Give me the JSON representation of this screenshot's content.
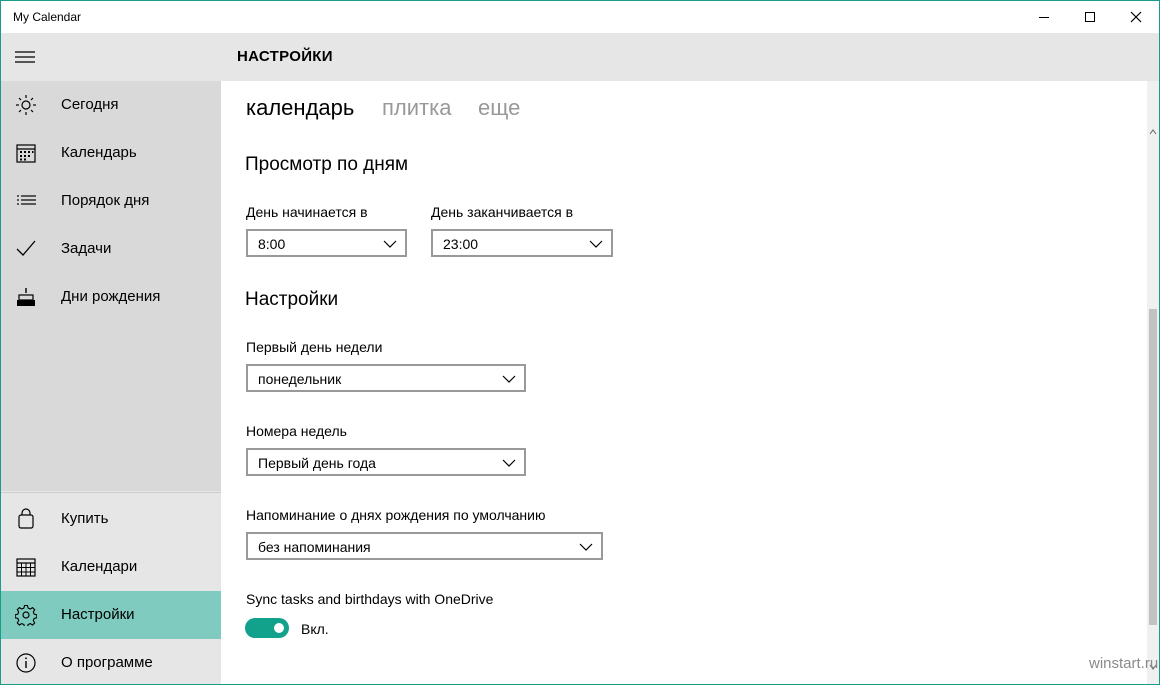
{
  "app": {
    "title": "My Calendar"
  },
  "header": {
    "title": "НАСТРОЙКИ"
  },
  "sidebar": {
    "items": [
      {
        "label": "Сегодня",
        "icon": "sun-icon"
      },
      {
        "label": "Календарь",
        "icon": "calendar-icon"
      },
      {
        "label": "Порядок дня",
        "icon": "list-icon"
      },
      {
        "label": "Задачи",
        "icon": "checkmark-icon"
      },
      {
        "label": "Дни рождения",
        "icon": "cake-icon"
      }
    ],
    "bottom_items": [
      {
        "label": "Купить",
        "icon": "shopping-bag-icon"
      },
      {
        "label": "Календари",
        "icon": "calendar-grid-icon"
      },
      {
        "label": "Настройки",
        "icon": "gear-icon",
        "selected": true
      },
      {
        "label": "О программе",
        "icon": "info-icon"
      }
    ]
  },
  "pivot": {
    "items": [
      {
        "label": "календарь",
        "selected": true
      },
      {
        "label": "плитка",
        "selected": false
      },
      {
        "label": "еще",
        "selected": false
      }
    ]
  },
  "day_view": {
    "title": "Просмотр по дням",
    "start_label": "День начинается в",
    "start_value": "8:00",
    "end_label": "День заканчивается в",
    "end_value": "23:00"
  },
  "settings": {
    "title": "Настройки",
    "first_day_label": "Первый день недели",
    "first_day_value": "понедельник",
    "week_numbers_label": "Номера недель",
    "week_numbers_value": "Первый день года",
    "birthday_reminder_label": "Напоминание о днях рождения по умолчанию",
    "birthday_reminder_value": "без напоминания",
    "sync_label": "Sync tasks and birthdays with OneDrive",
    "sync_state_text": "Вкл.",
    "sync_on": true
  },
  "watermark": "winstart.ru",
  "colors": {
    "accent": "#12a28b",
    "selected_nav": "#7fcbbf",
    "sidebar_bg": "#e6e6e6",
    "header_bg": "#e6e6e6"
  }
}
